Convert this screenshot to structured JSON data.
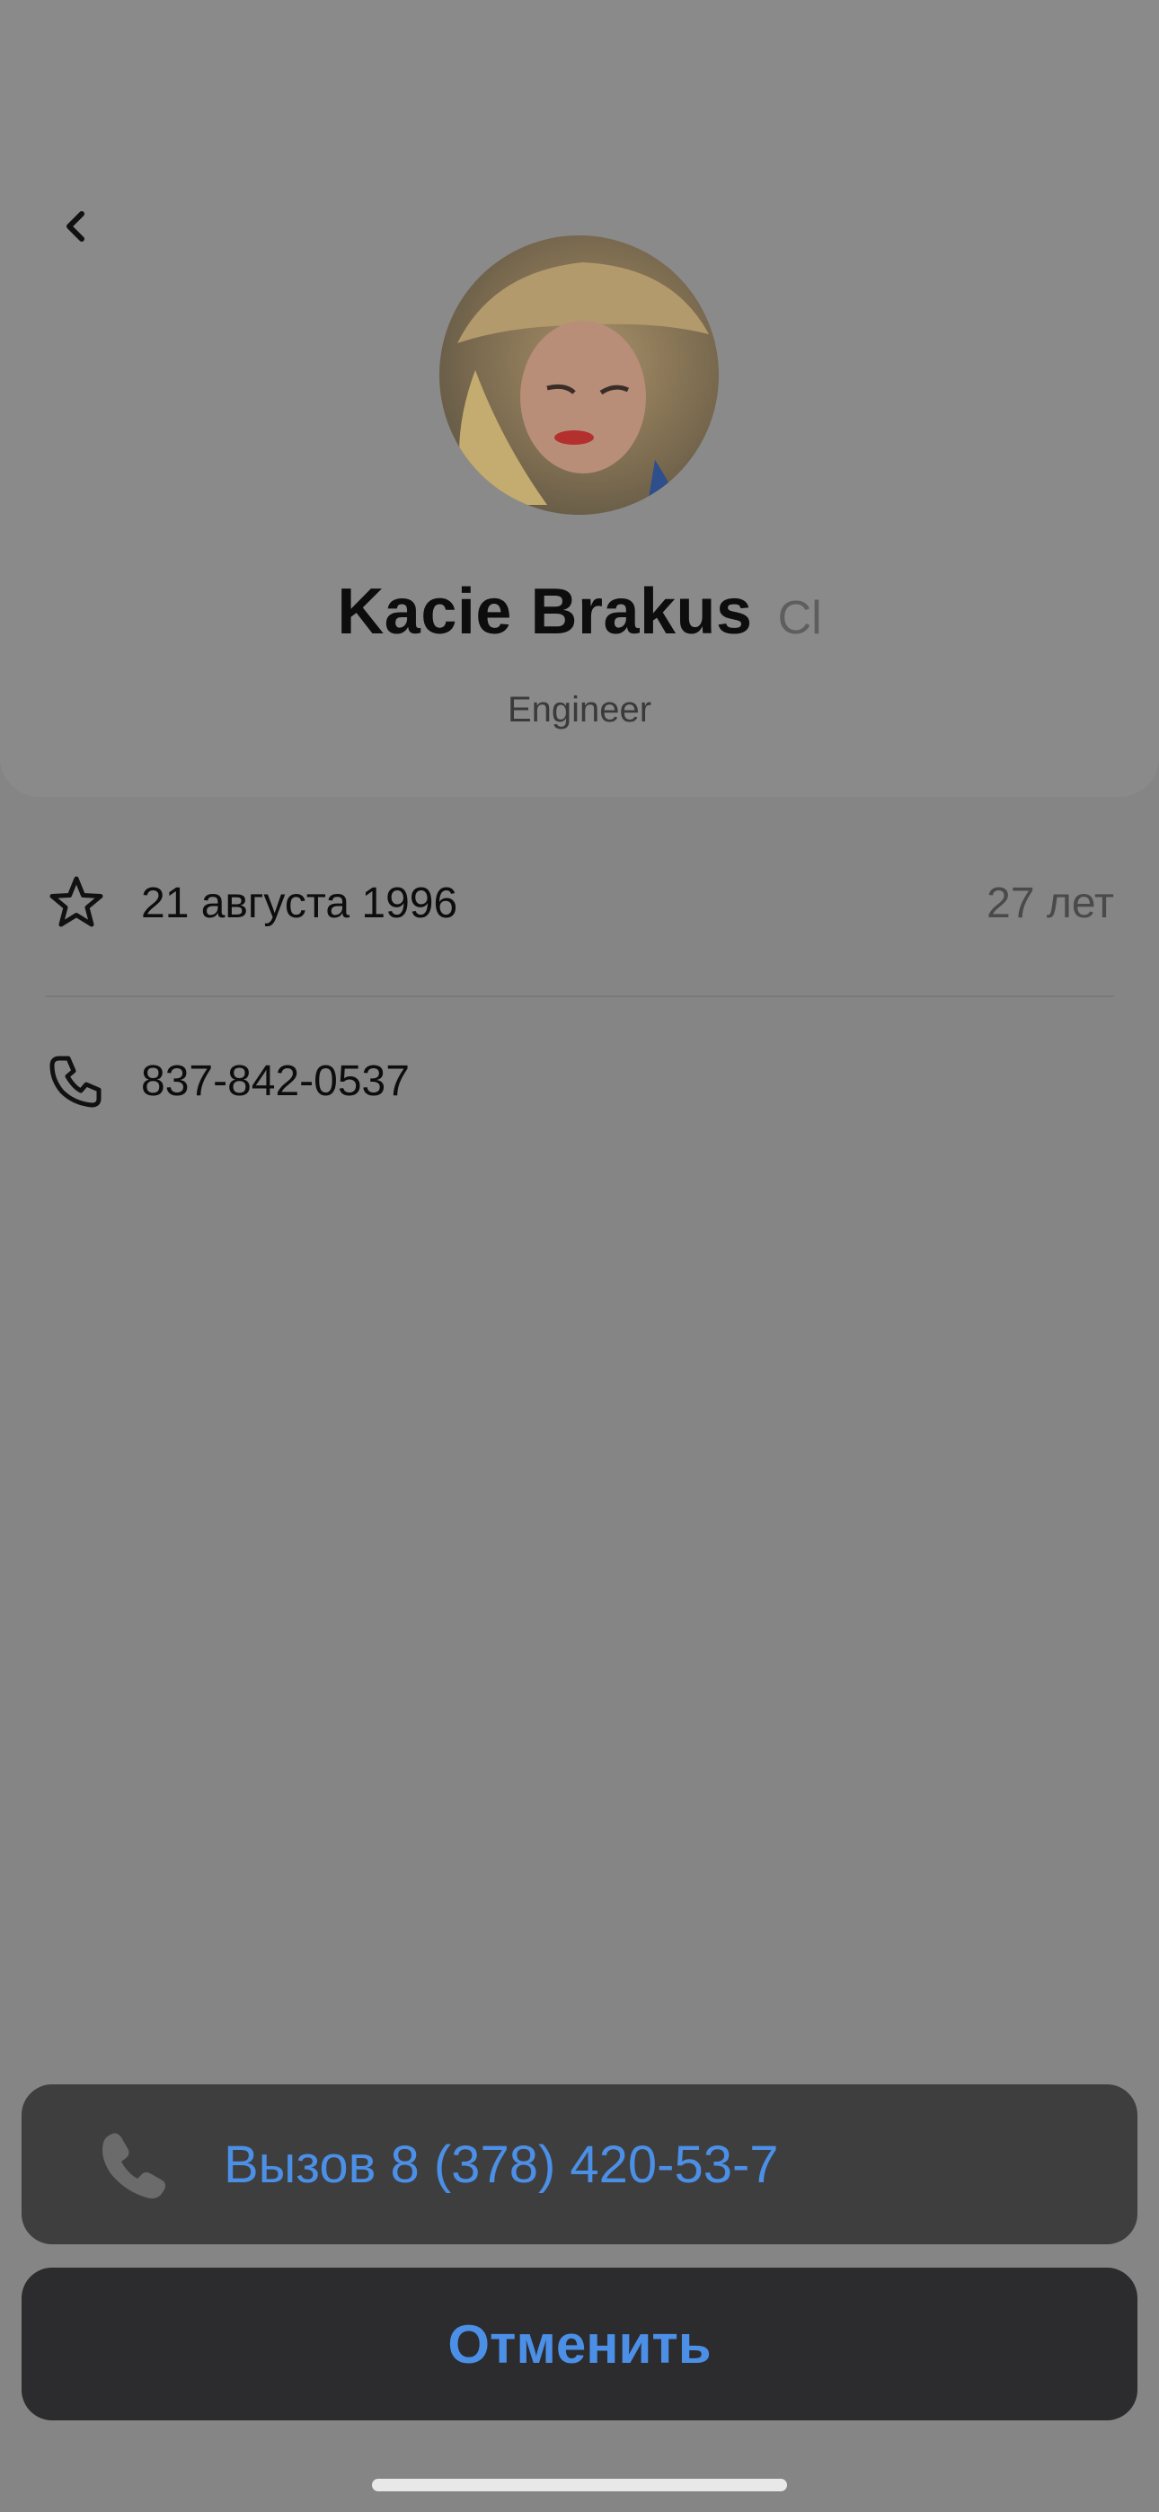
{
  "profile": {
    "name": "Kacie Brakus",
    "name_suffix": "Cl",
    "role": "Engineer"
  },
  "birthday_row": {
    "icon": "star-icon",
    "date": "21 августа 1996",
    "age": "27 лет"
  },
  "phone_row": {
    "icon": "phone-icon",
    "number": "837-842-0537"
  },
  "action_sheet": {
    "call_label": "Вызов 8 (378) 420-53-7",
    "cancel_label": "Отменить"
  },
  "colors": {
    "accent": "#4c8fe6",
    "background": "#858585",
    "sheet": "#3e3e3e",
    "cancel": "#2c2c2e"
  }
}
